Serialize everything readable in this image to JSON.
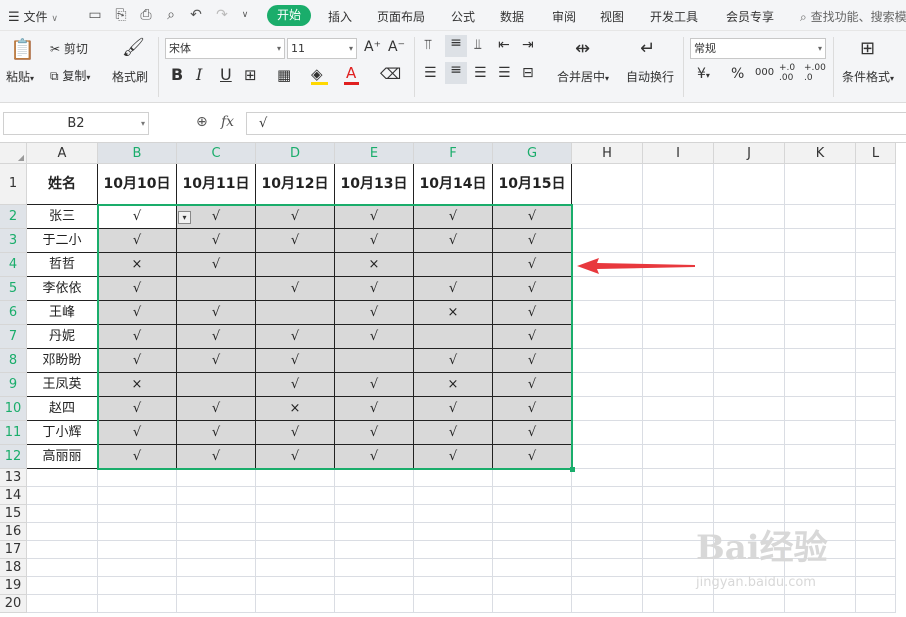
{
  "menubar": {
    "file_menu": "文件",
    "tabs": [
      "开始",
      "插入",
      "页面布局",
      "公式",
      "数据",
      "审阅",
      "视图",
      "开发工具",
      "会员专享"
    ],
    "search_placeholder": "查找功能、搜索模"
  },
  "ribbon": {
    "paste": "粘贴",
    "cut": "剪切",
    "copy": "复制",
    "format_painter": "格式刷",
    "font_name": "宋体",
    "font_size": "11",
    "bold": "B",
    "italic": "I",
    "underline": "U",
    "merge_center": "合并居中",
    "wrap_text": "自动换行",
    "number_format": "常规",
    "currency": "¥",
    "percent": "%",
    "thousands": "000",
    "inc_decimal": "+.0 .00",
    "dec_decimal": "+.00 .0",
    "conditional_format": "条件格式",
    "accent_color": "#1aad6b",
    "font_color_bar": "#e02020",
    "fill_color_bar": "#ffd800"
  },
  "formula_bar": {
    "name_box": "B2",
    "fx": "fx",
    "formula": "√"
  },
  "sheet": {
    "columns": [
      "A",
      "B",
      "C",
      "D",
      "E",
      "F",
      "G",
      "H",
      "I",
      "J",
      "K",
      "L"
    ],
    "rows": [
      "1",
      "2",
      "3",
      "4",
      "5",
      "6",
      "7",
      "8",
      "9",
      "10",
      "11",
      "12",
      "13",
      "14",
      "15",
      "16",
      "17",
      "18",
      "19",
      "20"
    ],
    "header_row": [
      "姓名",
      "10月10日",
      "10月11日",
      "10月12日",
      "10月13日",
      "10月14日",
      "10月15日"
    ],
    "data": [
      [
        "张三",
        "√",
        "√",
        "√",
        "√",
        "√",
        "√"
      ],
      [
        "于二小",
        "√",
        "√",
        "√",
        "√",
        "√",
        "√"
      ],
      [
        "哲哲",
        "×",
        "√",
        "",
        "×",
        "",
        "√"
      ],
      [
        "李依依",
        "√",
        "",
        "√",
        "√",
        "√",
        "√"
      ],
      [
        "王峰",
        "√",
        "√",
        "",
        "√",
        "×",
        "√"
      ],
      [
        "丹妮",
        "√",
        "√",
        "√",
        "√",
        "",
        "√"
      ],
      [
        "邓盼盼",
        "√",
        "√",
        "√",
        "",
        "√",
        "√"
      ],
      [
        "王凤英",
        "×",
        "",
        "√",
        "√",
        "×",
        "√"
      ],
      [
        "赵四",
        "√",
        "√",
        "×",
        "√",
        "√",
        "√"
      ],
      [
        "丁小辉",
        "√",
        "√",
        "√",
        "√",
        "√",
        "√"
      ],
      [
        "高丽丽",
        "√",
        "√",
        "√",
        "√",
        "√",
        "√"
      ]
    ],
    "selection": "B2:G12",
    "highlight_color": "#1aad6b",
    "arrow_color": "#e8383d"
  },
  "watermark": {
    "text": "Bai经验",
    "url_text": "jingyan.baidu.com"
  }
}
